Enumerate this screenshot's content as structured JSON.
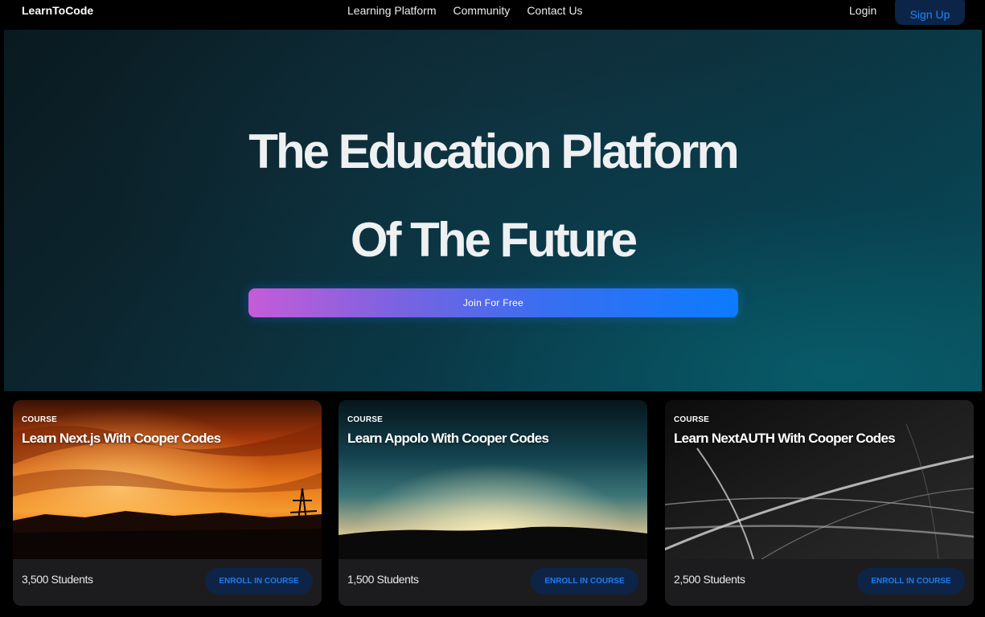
{
  "navbar": {
    "brand": "LearnToCode",
    "links": [
      "Learning Platform",
      "Community",
      "Contact Us"
    ],
    "login_label": "Login",
    "signup_label": "Sign Up"
  },
  "hero": {
    "title_line1": "The Education Platform",
    "title_line2": "Of The Future",
    "cta_label": "Join For Free"
  },
  "courses": [
    {
      "kicker": "COURSE",
      "title": "Learn Next.js With Cooper Codes",
      "students": "3,500 Students",
      "enroll_label": "ENROLL IN COURSE",
      "image": "orange-sunset-landscape"
    },
    {
      "kicker": "COURSE",
      "title": "Learn Appolo With Cooper Codes",
      "students": "1,500 Students",
      "enroll_label": "ENROLL IN COURSE",
      "image": "teal-dawn-horizon"
    },
    {
      "kicker": "COURSE",
      "title": "Learn NextAUTH With Cooper Codes",
      "students": "2,500 Students",
      "enroll_label": "ENROLL IN COURSE",
      "image": "abstract-light-streaks"
    }
  ],
  "colors": {
    "accent_blue": "#1f86ff",
    "cta_gradient_start": "#c65bd8",
    "cta_gradient_end": "#0b7bff",
    "button_dark_blue": "#0e2446"
  }
}
